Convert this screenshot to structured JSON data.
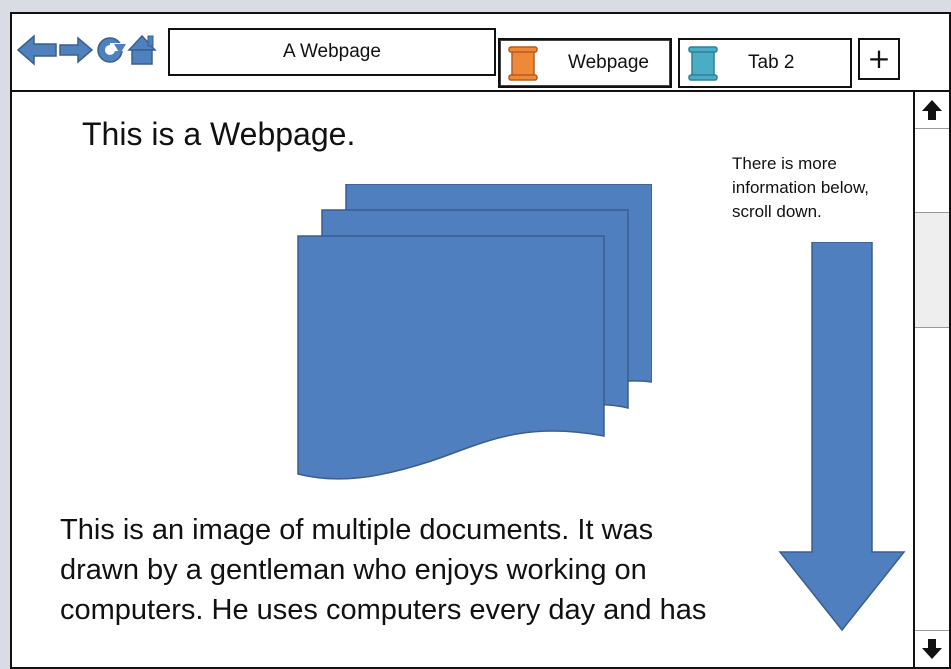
{
  "toolbar": {
    "address_text": "A Webpage",
    "nav_icons": [
      "back-arrow-icon",
      "forward-arrow-icon",
      "refresh-icon",
      "home-icon"
    ]
  },
  "tabs": [
    {
      "label": "Webpage",
      "icon": "orange-scroll-icon",
      "color": "#f0883a",
      "active": true
    },
    {
      "label": "Tab 2",
      "icon": "blue-scroll-icon",
      "color": "#4bacc6",
      "active": false
    }
  ],
  "new_tab_label": "+",
  "page": {
    "heading": "This is a Webpage.",
    "note": "There is more information below, scroll down.",
    "paragraph_lines": [
      "This is an image of multiple documents.  It was",
      "drawn by a gentleman who enjoys working on",
      "computers.  He uses computers every day and has"
    ]
  },
  "colors": {
    "shape_fill": "#4f7fbf",
    "shape_stroke": "#3a5f8f"
  }
}
